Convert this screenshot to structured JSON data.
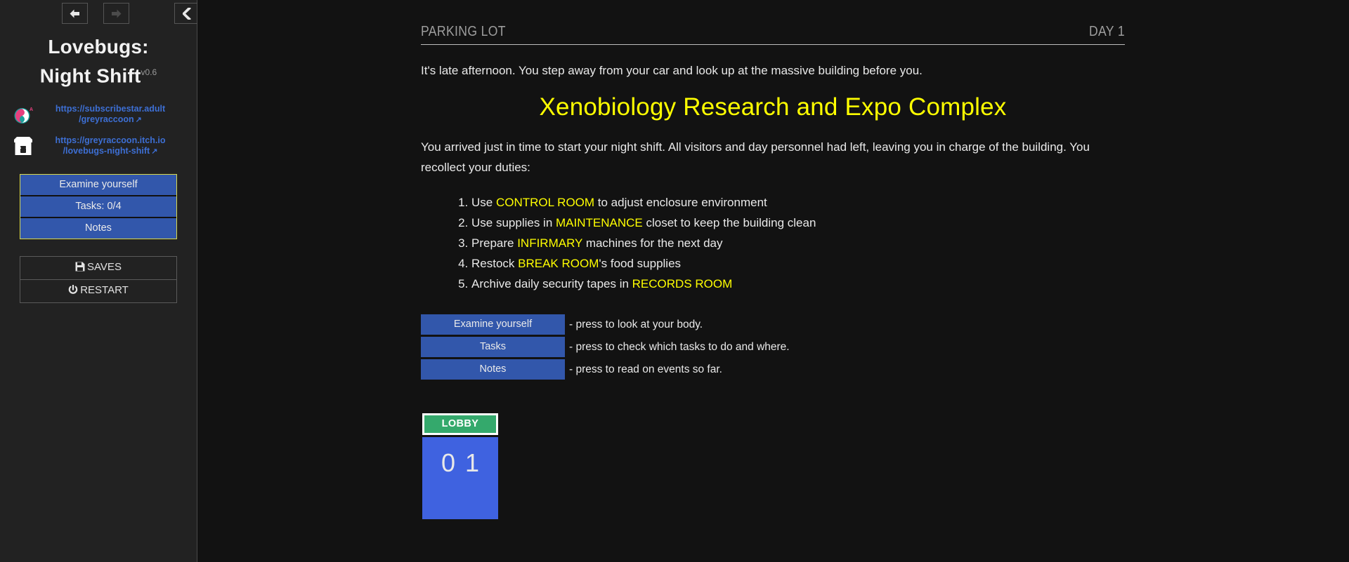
{
  "window": {
    "background": "#121212",
    "sidebar_background": "#222222",
    "accent_blue": "#3257ab",
    "accent_yellow": "#ffff00",
    "link_blue": "#3d6fd4",
    "room_green": "#34a96c",
    "room_blue": "#3f62e0"
  },
  "nav": {
    "back_icon": "arrow-left-icon",
    "forward_icon": "arrow-right-icon",
    "collapse_icon": "chevron-left-icon"
  },
  "sidebar": {
    "title_line1": "Lovebugs:",
    "title_line2": "Night Shift",
    "version": "v0.6",
    "links": [
      {
        "icon": "subscribestar-icon",
        "line1": "https://subscribestar.adult",
        "line2": "/greyraccoon",
        "external_glyph": "↗"
      },
      {
        "icon": "itchio-icon",
        "line1": "https://greyraccoon.itch.io",
        "line2": "/lovebugs-night-shift",
        "external_glyph": "↗"
      }
    ],
    "game_buttons": [
      {
        "label": "Examine yourself",
        "name": "examine-yourself-button"
      },
      {
        "label": "Tasks: 0/4",
        "name": "tasks-button"
      },
      {
        "label": "Notes",
        "name": "notes-button"
      }
    ],
    "system_buttons": [
      {
        "label": "SAVES",
        "icon": "floppy-disk-icon",
        "name": "saves-button"
      },
      {
        "label": "RESTART",
        "icon": "power-icon",
        "name": "restart-button"
      }
    ]
  },
  "scene": {
    "location": "PARKING LOT",
    "day": "DAY 1",
    "intro": "It's late afternoon. You step away from your car and look up at the massive building before you.",
    "building_title": "Xenobiology Research and Expo Complex",
    "briefing": "You arrived just in time to start your night shift. All visitors and day personnel had left, leaving you in charge of the building. You recollect your duties:",
    "duties": [
      {
        "pre": "Use ",
        "keyword": "CONTROL ROOM",
        "post": " to adjust enclosure environment"
      },
      {
        "pre": "Use supplies in ",
        "keyword": "MAINTENANCE",
        "post": " closet to keep the building clean"
      },
      {
        "pre": "Prepare ",
        "keyword": "INFIRMARY",
        "post": " machines for the next day"
      },
      {
        "pre": "Restock ",
        "keyword": "BREAK ROOM",
        "post": "'s food supplies"
      },
      {
        "pre": "Archive daily security tapes in ",
        "keyword": "RECORDS ROOM",
        "post": ""
      }
    ],
    "legend": [
      {
        "button": "Examine yourself",
        "desc": "- press to look at your body.",
        "name": "legend-examine-yourself-button"
      },
      {
        "button": "Tasks",
        "desc": "- press to check which tasks to do and where.",
        "name": "legend-tasks-button"
      },
      {
        "button": "Notes",
        "desc": "- press to read on events so far.",
        "name": "legend-notes-button"
      }
    ],
    "room": {
      "label": "LOBBY",
      "exit_left": "0",
      "exit_right": "1"
    }
  }
}
